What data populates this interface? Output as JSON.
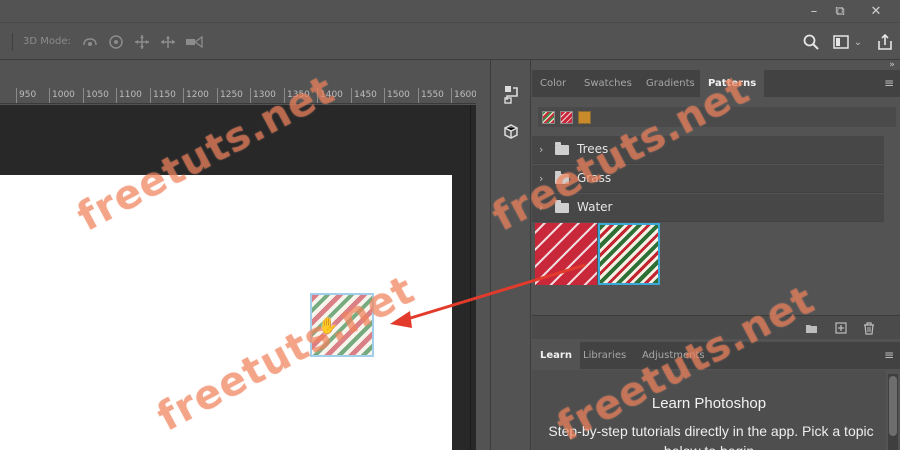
{
  "toolbar": {
    "mode_label": "3D Mode:",
    "icons": [
      "orbit-3d-icon",
      "roll-3d-icon",
      "pan-3d-icon",
      "slide-3d-icon",
      "scale-3d-icon"
    ]
  },
  "window_controls": {
    "minimize": "–",
    "restore": "⧉",
    "close": "✕"
  },
  "ruler": {
    "labels": [
      "950",
      "1000",
      "1050",
      "1100",
      "1150",
      "1200",
      "1250",
      "1300",
      "1350",
      "1400",
      "1450",
      "1500",
      "1550",
      "1600"
    ]
  },
  "patterns_panel": {
    "tabs": [
      "Color",
      "Swatches",
      "Gradients",
      "Patterns"
    ],
    "active_tab": "Patterns",
    "groups": [
      {
        "name": "Trees"
      },
      {
        "name": "Grass"
      },
      {
        "name": "Water"
      }
    ]
  },
  "learn_panel": {
    "tabs": [
      "Learn",
      "Libraries",
      "Adjustments"
    ],
    "active_tab": "Learn",
    "title": "Learn Photoshop",
    "description": "Step-by-step tutorials directly in the app. Pick a topic below to begin."
  },
  "watermark": {
    "text": "freetuts.net"
  },
  "colors": {
    "ui_background": "#535353",
    "canvas_background": "#282828",
    "selection_border": "#3aa8d8",
    "watermark": "#ED784E",
    "arrow": "#E33B2B"
  }
}
